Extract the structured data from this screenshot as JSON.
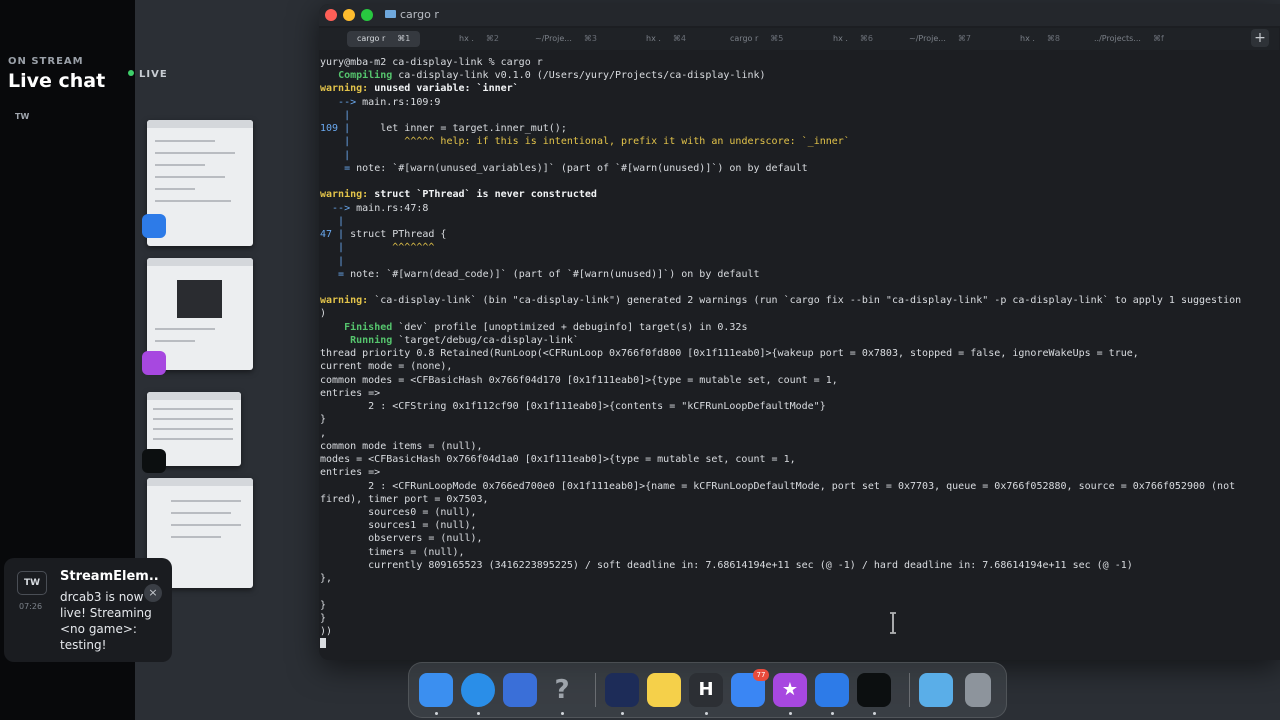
{
  "stream_panel": {
    "on_stream_label": "ON STREAM",
    "title": "Live chat",
    "tw_label": "TW",
    "live_label": "LIVE"
  },
  "notification": {
    "logo": "TW",
    "time": "07:26",
    "title": "StreamElem...",
    "body_lines": [
      "drcab3 is now",
      "live! Streaming",
      "<no game>:",
      "testing!"
    ]
  },
  "terminal": {
    "window_title": "cargo r",
    "tabs": [
      {
        "label": "cargo r",
        "shortcut": "⌘1",
        "active": true
      },
      {
        "label": "hx .",
        "shortcut": "⌘2"
      },
      {
        "label": "~/Proje...",
        "shortcut": "⌘3"
      },
      {
        "label": "hx .",
        "shortcut": "⌘4"
      },
      {
        "label": "cargo r",
        "shortcut": "⌘5"
      },
      {
        "label": "hx .",
        "shortcut": "⌘6"
      },
      {
        "label": "~/Proje...",
        "shortcut": "⌘7"
      },
      {
        "label": "hx .",
        "shortcut": "⌘8"
      },
      {
        "label": "../Projects...",
        "shortcut": "⌘f"
      }
    ],
    "new_tab_icon": "+",
    "lines": [
      "yury@mba-m2 ca-display-link % cargo r",
      "   Compiling ca-display-link v0.1.0 (/Users/yury/Projects/ca-display-link)",
      "warning: unused variable: `inner`",
      "   --> main.rs:109:9",
      "    |",
      "109 |     let inner = target.inner_mut();",
      "    |         ^^^^^ help: if this is intentional, prefix it with an underscore: `_inner`",
      "    |",
      "    = note: `#[warn(unused_variables)]` (part of `#[warn(unused)]`) on by default",
      "",
      "warning: struct `PThread` is never constructed",
      "  --> main.rs:47:8",
      "   |",
      "47 | struct PThread {",
      "   |        ^^^^^^^",
      "   |",
      "   = note: `#[warn(dead_code)]` (part of `#[warn(unused)]`) on by default",
      "",
      "warning: `ca-display-link` (bin \"ca-display-link\") generated 2 warnings (run `cargo fix --bin \"ca-display-link\" -p ca-display-link` to apply 1 suggestion",
      ")",
      "    Finished `dev` profile [unoptimized + debuginfo] target(s) in 0.32s",
      "     Running `target/debug/ca-display-link`",
      "thread priority 0.8 Retained(RunLoop(<CFRunLoop 0x766f0fd800 [0x1f111eab0]>{wakeup port = 0x7803, stopped = false, ignoreWakeUps = true,",
      "current mode = (none),",
      "common modes = <CFBasicHash 0x766f04d170 [0x1f111eab0]>{type = mutable set, count = 1,",
      "entries =>",
      "        2 : <CFString 0x1f112cf90 [0x1f111eab0]>{contents = \"kCFRunLoopDefaultMode\"}",
      "}",
      ",",
      "common mode items = (null),",
      "modes = <CFBasicHash 0x766f04d1a0 [0x1f111eab0]>{type = mutable set, count = 1,",
      "entries =>",
      "        2 : <CFRunLoopMode 0x766ed700e0 [0x1f111eab0]>{name = kCFRunLoopDefaultMode, port set = 0x7703, queue = 0x766f052880, source = 0x766f052900 (not",
      "fired), timer port = 0x7503,",
      "        sources0 = (null),",
      "        sources1 = (null),",
      "        observers = (null),",
      "        timers = (null),",
      "        currently 809165523 (3416223895225) / soft deadline in: 7.68614194e+11 sec (@ -1) / hard deadline in: 7.68614194e+11 sec (@ -1)",
      "},",
      "",
      "}",
      "}",
      "))",
      ""
    ]
  },
  "dock": {
    "apps": [
      {
        "name": "finder-app",
        "color": "#3b8ff0"
      },
      {
        "name": "safari-app",
        "color": "#2a8ee8"
      },
      {
        "name": "simulator-app",
        "color": "#3a6fd8"
      },
      {
        "name": "help-app",
        "color": "#444a52",
        "glyph": "?"
      },
      {
        "name": "screen-app",
        "color": "#1d2c58"
      },
      {
        "name": "notes-app",
        "color": "#f5d04a"
      },
      {
        "name": "helix-app",
        "color": "#2c2f34",
        "glyph": "H"
      },
      {
        "name": "mail-app",
        "color": "#3a86f4",
        "badge": "77"
      },
      {
        "name": "feedback-app",
        "color": "#a748e0",
        "glyph": "★"
      },
      {
        "name": "xcode-app",
        "color": "#2d7be8"
      },
      {
        "name": "activity-app",
        "color": "#0c0f10"
      },
      {
        "name": "downloads-folder",
        "color": "#5aaee8"
      },
      {
        "name": "trash-app",
        "color": "#8d949c"
      }
    ]
  },
  "colors": {
    "warning": "#e2c34a",
    "success": "#55c46d",
    "path_blue": "#6aa9f0",
    "live_green": "#3ecf6a"
  }
}
